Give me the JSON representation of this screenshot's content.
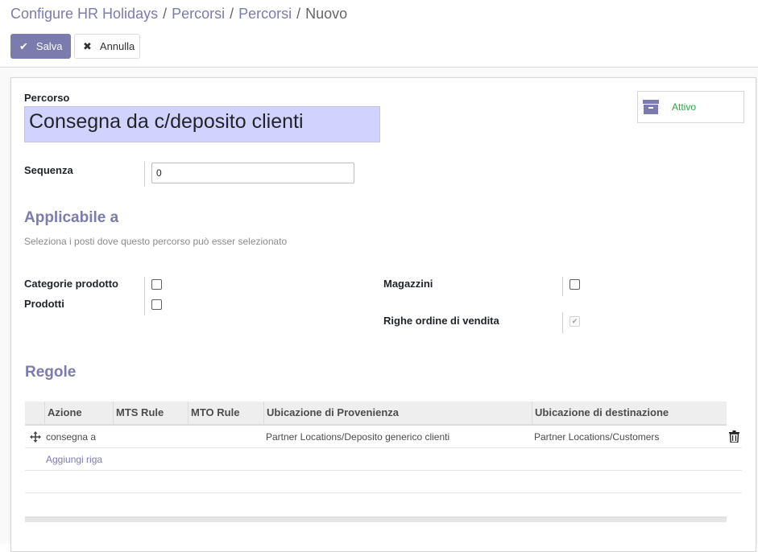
{
  "breadcrumb": {
    "items": [
      "Configure HR Holidays",
      "Percorsi",
      "Percorsi"
    ],
    "current": "Nuovo",
    "separator": "/"
  },
  "toolbar": {
    "save_label": "Salva",
    "discard_label": "Annulla"
  },
  "active_button": {
    "label": "Attivo",
    "icon": "archive-icon"
  },
  "form": {
    "name_label": "Percorso",
    "name_value": "Consegna da c/deposito clienti",
    "sequence_label": "Sequenza",
    "sequence_value": "0"
  },
  "applicable": {
    "title": "Applicabile a",
    "help": "Seleziona i posti dove questo percorso può esser selezionato",
    "product_categories_label": "Categorie prodotto",
    "products_label": "Prodotti",
    "warehouses_label": "Magazzini",
    "sale_lines_label": "Righe ordine di vendita",
    "product_categories_checked": false,
    "products_checked": false,
    "warehouses_checked": false,
    "sale_lines_checked": true
  },
  "rules": {
    "title": "Regole",
    "columns": [
      "Azione",
      "MTS Rule",
      "MTO Rule",
      "Ubicazione di Provenienza",
      "Ubicazione di destinazione"
    ],
    "rows": [
      {
        "action": "consegna a",
        "mts_rule": "",
        "mto_rule": "",
        "source": "Partner Locations/Deposito generico clienti",
        "destination": "Partner Locations/Customers"
      }
    ],
    "add_line_label": "Aggiungi riga"
  },
  "colors": {
    "primary": "#7c7bad",
    "active_green": "#28a745",
    "name_field_bg": "#d2d2ff"
  }
}
